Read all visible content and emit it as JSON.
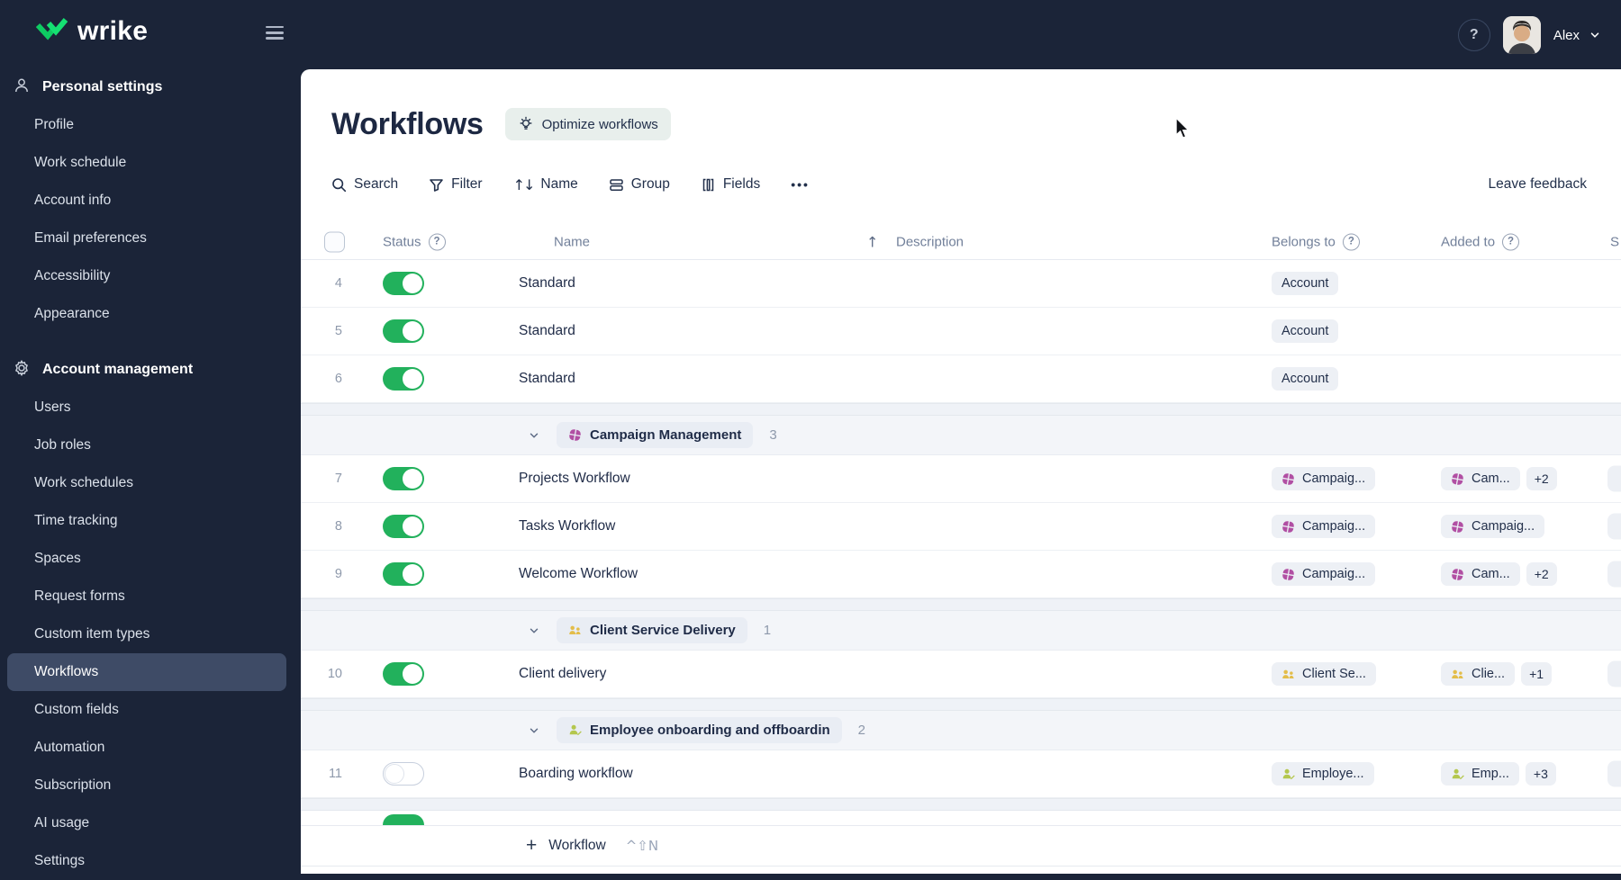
{
  "topbar": {
    "logo_text": "wrike",
    "user_name": "Alex"
  },
  "sidebar": {
    "sections": [
      {
        "label": "Personal settings",
        "icon": "person-icon",
        "items": [
          "Profile",
          "Work schedule",
          "Account info",
          "Email preferences",
          "Accessibility",
          "Appearance"
        ]
      },
      {
        "label": "Account management",
        "icon": "gear-icon",
        "items": [
          "Users",
          "Job roles",
          "Work schedules",
          "Time tracking",
          "Spaces",
          "Request forms",
          "Custom item types",
          "Workflows",
          "Custom fields",
          "Automation",
          "Subscription",
          "AI usage",
          "Settings"
        ],
        "selected": "Workflows"
      }
    ]
  },
  "header": {
    "title": "Workflows",
    "optimize_label": "Optimize workflows"
  },
  "toolbar": {
    "search_label": "Search",
    "filter_label": "Filter",
    "sort_label": "Name",
    "group_label": "Group",
    "fields_label": "Fields",
    "leave_feedback": "Leave feedback"
  },
  "icons": {
    "help": "?",
    "sort_both": "↑↓",
    "sort_asc": "↑",
    "more": "•••",
    "plus": "+"
  },
  "colors": {
    "accent_green": "#22b15c",
    "brand_green": "#0ecb62",
    "dark_navy": "#1b2438",
    "spaces": {
      "campaign": "#b14fa3",
      "client": "#e3bd4a",
      "employee": "#b4c74e"
    }
  },
  "table": {
    "columns": {
      "status": "Status",
      "name": "Name",
      "description": "Description",
      "belongs_to": "Belongs to",
      "added_to": "Added to",
      "shared": "S"
    },
    "rows": [
      {
        "type": "data",
        "num": "4",
        "on": true,
        "name": "Standard",
        "belongs": {
          "text": "Account",
          "icon": null
        },
        "added": null,
        "sliver": false
      },
      {
        "type": "data",
        "num": "5",
        "on": true,
        "name": "Standard",
        "belongs": {
          "text": "Account",
          "icon": null
        },
        "added": null,
        "sliver": false
      },
      {
        "type": "data",
        "num": "6",
        "on": true,
        "name": "Standard",
        "belongs": {
          "text": "Account",
          "icon": null
        },
        "added": null,
        "sliver": false
      },
      {
        "type": "band"
      },
      {
        "type": "group",
        "icon": "campaign",
        "label": "Campaign Management",
        "count": "3"
      },
      {
        "type": "data",
        "num": "7",
        "on": true,
        "name": "Projects Workflow",
        "belongs": {
          "text": "Campaig...",
          "icon": "campaign"
        },
        "added": {
          "text": "Cam...",
          "icon": "campaign",
          "plus": "+2"
        },
        "sliver": true
      },
      {
        "type": "data",
        "num": "8",
        "on": true,
        "name": "Tasks Workflow",
        "belongs": {
          "text": "Campaig...",
          "icon": "campaign"
        },
        "added": {
          "text": "Campaig...",
          "icon": "campaign",
          "plus": null
        },
        "sliver": true
      },
      {
        "type": "data",
        "num": "9",
        "on": true,
        "name": "Welcome Workflow",
        "belongs": {
          "text": "Campaig...",
          "icon": "campaign"
        },
        "added": {
          "text": "Cam...",
          "icon": "campaign",
          "plus": "+2"
        },
        "sliver": true
      },
      {
        "type": "band"
      },
      {
        "type": "group",
        "icon": "client",
        "label": "Client Service Delivery",
        "count": "1"
      },
      {
        "type": "data",
        "num": "10",
        "on": true,
        "name": "Client delivery",
        "belongs": {
          "text": "Client Se...",
          "icon": "client"
        },
        "added": {
          "text": "Clie...",
          "icon": "client",
          "plus": "+1"
        },
        "sliver": true
      },
      {
        "type": "band"
      },
      {
        "type": "group",
        "icon": "employee",
        "label": "Employee onboarding and offboardin",
        "count": "2"
      },
      {
        "type": "data",
        "num": "11",
        "on": false,
        "name": "Boarding workflow",
        "belongs": {
          "text": "Employe...",
          "icon": "employee"
        },
        "added": {
          "text": "Emp...",
          "icon": "employee",
          "plus": "+3"
        },
        "sliver": true
      },
      {
        "type": "band"
      },
      {
        "type": "toggle-sliver"
      }
    ],
    "footer": {
      "add_label": "Workflow",
      "shortcut": "^⇧N"
    }
  }
}
